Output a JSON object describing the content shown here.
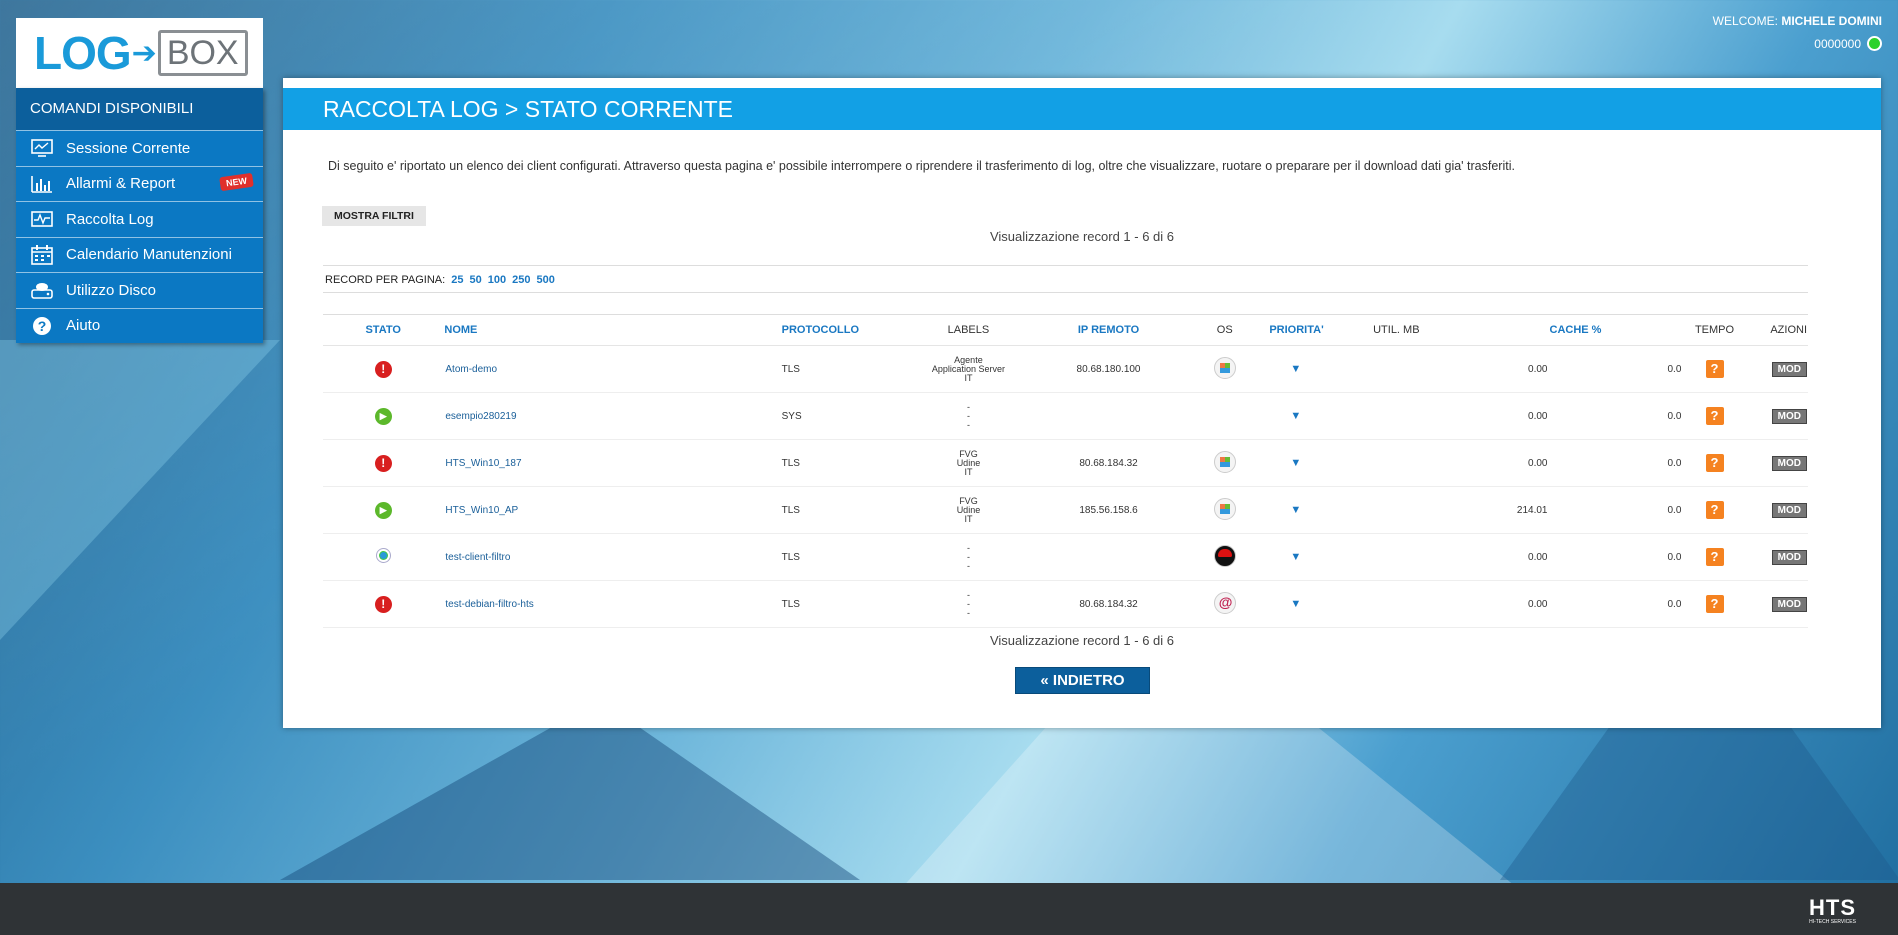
{
  "user": {
    "welcome_label": "WELCOME:",
    "name": "MICHELE DOMINI",
    "code": "0000000"
  },
  "sidebar": {
    "logo_left": "LOG",
    "logo_right": "BOX",
    "heading": "COMANDI DISPONIBILI",
    "items": [
      {
        "label": "Sessione Corrente",
        "icon": "monitor-icon"
      },
      {
        "label": "Allarmi & Report",
        "icon": "bar-chart-icon",
        "badge": "NEW"
      },
      {
        "label": "Raccolta Log",
        "icon": "pulse-icon"
      },
      {
        "label": "Calendario Manutenzioni",
        "icon": "calendar-icon"
      },
      {
        "label": "Utilizzo Disco",
        "icon": "disk-icon"
      },
      {
        "label": "Aiuto",
        "icon": "help-icon"
      }
    ]
  },
  "main": {
    "title": "RACCOLTA LOG > STATO CORRENTE",
    "intro": "Di seguito e' riportato un elenco dei client configurati. Attraverso questa pagina e' possibile interrompere o riprendere il trasferimento di log, oltre che visualizzare, ruotare o preparare per il download dati gia' trasferiti.",
    "filter_button": "MOSTRA FILTRI",
    "record_info": "Visualizzazione record 1 - 6 di 6",
    "records_per_page_label": "RECORD PER PAGINA:",
    "records_per_page_options": [
      "25",
      "50",
      "100",
      "250",
      "500"
    ],
    "back_button": "« INDIETRO"
  },
  "table": {
    "headers": {
      "stato": "STATO",
      "nome": "NOME",
      "protocollo": "PROTOCOLLO",
      "labels": "LABELS",
      "ip": "IP REMOTO",
      "os": "OS",
      "priorita": "PRIORITA'",
      "util": "UTIL. MB",
      "cache": "CACHE %",
      "tempo": "TEMPO",
      "azioni": "AZIONI"
    },
    "rows": [
      {
        "status": "stopped",
        "name": "Atom-demo",
        "protocol": "TLS",
        "labels": [
          "Agente",
          "Application Server",
          "IT"
        ],
        "ip": "80.68.180.100",
        "os": "windows",
        "util": "0.00",
        "cache": "0.0",
        "tempo": "?",
        "action": "MOD"
      },
      {
        "status": "running",
        "name": "esempio280219",
        "protocol": "SYS",
        "labels": [
          "-",
          "-",
          "-"
        ],
        "ip": "",
        "os": "",
        "util": "0.00",
        "cache": "0.0",
        "tempo": "?",
        "action": "MOD"
      },
      {
        "status": "stopped",
        "name": "HTS_Win10_187",
        "protocol": "TLS",
        "labels": [
          "FVG",
          "Udine",
          "IT"
        ],
        "ip": "80.68.184.32",
        "os": "windows",
        "util": "0.00",
        "cache": "0.0",
        "tempo": "?",
        "action": "MOD"
      },
      {
        "status": "running",
        "name": "HTS_Win10_AP",
        "protocol": "TLS",
        "labels": [
          "FVG",
          "Udine",
          "IT"
        ],
        "ip": "185.56.158.6",
        "os": "windows",
        "util": "214.01",
        "cache": "0.0",
        "tempo": "?",
        "action": "MOD"
      },
      {
        "status": "waiting",
        "name": "test-client-filtro",
        "protocol": "TLS",
        "labels": [
          "-",
          "-",
          "-"
        ],
        "ip": "",
        "os": "redhat",
        "util": "0.00",
        "cache": "0.0",
        "tempo": "?",
        "action": "MOD"
      },
      {
        "status": "stopped",
        "name": "test-debian-filtro-hts",
        "protocol": "TLS",
        "labels": [
          "-",
          "-",
          "-"
        ],
        "ip": "80.68.184.32",
        "os": "debian",
        "util": "0.00",
        "cache": "0.0",
        "tempo": "?",
        "action": "MOD"
      }
    ]
  },
  "footer": {
    "logo": "HTS",
    "logo_sub": "HI-TECH SERVICES"
  },
  "colors": {
    "accent": "#12a0e5",
    "sidebar": "#0b78c3",
    "sidebar_head": "#0c5f9c",
    "stopped": "#d81f1f",
    "running": "#5cb82b",
    "tempo": "#f58220"
  }
}
